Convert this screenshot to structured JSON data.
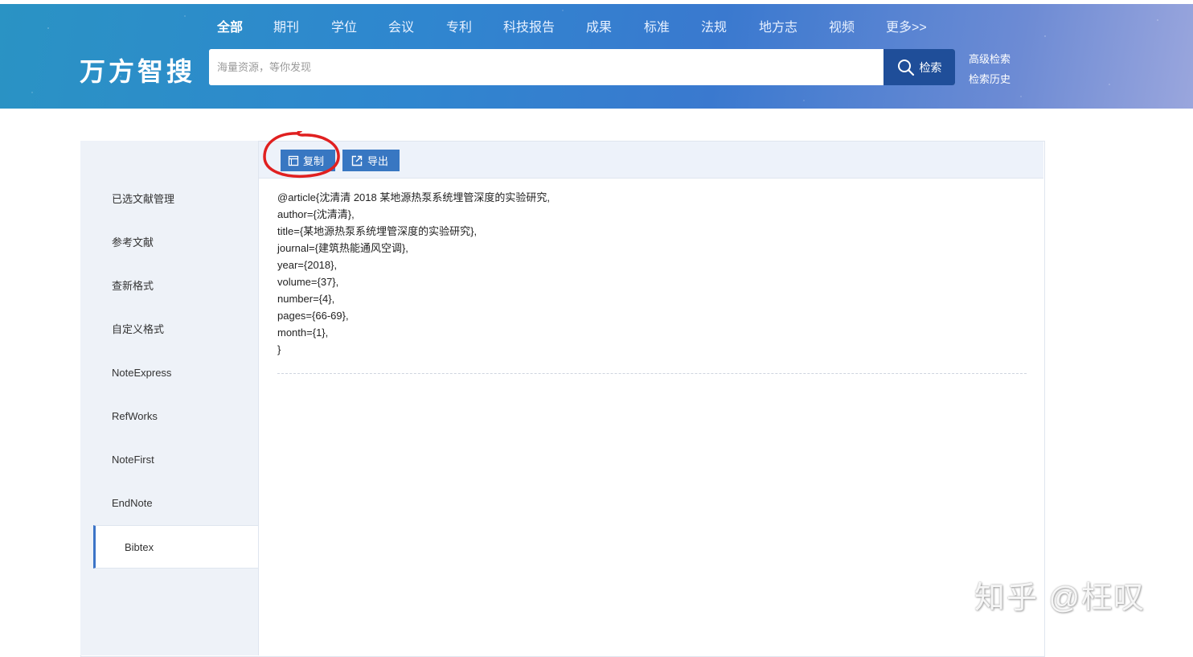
{
  "header": {
    "logo": "万方智搜",
    "nav": [
      "全部",
      "期刊",
      "学位",
      "会议",
      "专利",
      "科技报告",
      "成果",
      "标准",
      "法规",
      "地方志",
      "视频",
      "更多>>"
    ],
    "active_nav": 0,
    "search": {
      "placeholder": "海量资源，等你发现",
      "value": "",
      "button_label": "检索"
    },
    "advanced_search": "高级检索",
    "search_history": "检索历史"
  },
  "sidebar": {
    "items": [
      "已选文献管理",
      "参考文献",
      "查新格式",
      "自定义格式",
      "NoteExpress",
      "RefWorks",
      "NoteFirst",
      "EndNote",
      "Bibtex"
    ],
    "active_index": 8
  },
  "toolbar": {
    "copy_label": "复制",
    "export_label": "导出"
  },
  "citation": {
    "lines": [
      "@article{沈清清 2018 某地源热泵系统埋管深度的实验研究,",
      "author={沈清清},",
      "title={某地源热泵系统埋管深度的实验研究},",
      "journal={建筑热能通风空调},",
      "year={2018},",
      "volume={37},",
      "number={4},",
      "pages={66-69},",
      "month={1},",
      "}"
    ]
  },
  "watermark": "知乎 @枉叹",
  "colors": {
    "header_start": "#2a93c4",
    "header_end": "#9aa6dd",
    "search_btn": "#1f4e99",
    "tool_btn": "#3877c2",
    "annotation": "#e02020"
  }
}
